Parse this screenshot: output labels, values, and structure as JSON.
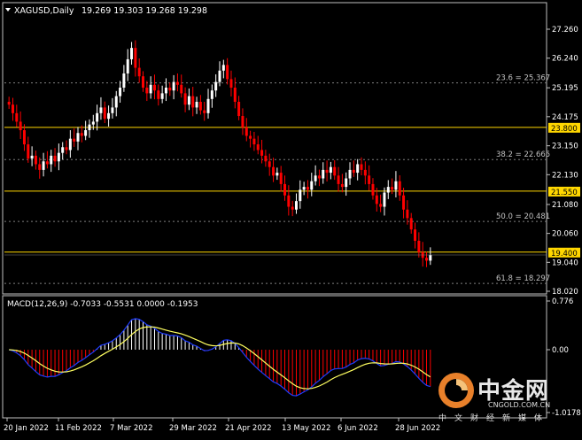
{
  "header": {
    "symbol": "XAGUSD,Daily",
    "ohlc": "19.269 19.303 19.268 19.298"
  },
  "price_axis": {
    "labels": [
      "27.260",
      "26.240",
      "25.195",
      "24.175",
      "23.150",
      "22.130",
      "21.080",
      "20.060",
      "19.040",
      "18.020"
    ],
    "highlighted": [
      {
        "text": "23.800",
        "value": 23.8,
        "color": "#ffd700",
        "text_color": "#000000"
      },
      {
        "text": "21.550",
        "value": 21.55,
        "color": "#ffd700",
        "text_color": "#000000"
      },
      {
        "text": "19.400",
        "value": 19.4,
        "color": "#ffd700",
        "text_color": "#000000"
      }
    ]
  },
  "fib_levels": [
    {
      "label": "23.6 = 25.367",
      "value": 25.367
    },
    {
      "label": "38.2 = 22.665",
      "value": 22.665
    },
    {
      "label": "50.0 = 20.481",
      "value": 20.481
    },
    {
      "label": "61.8 = 18.297",
      "value": 18.297
    }
  ],
  "macd": {
    "label": "MACD(12,26,9) -0.7033 -0.5531 0.0000 -0.1953",
    "axis_labels": [
      "0.776",
      "0.00",
      "-1.0178"
    ]
  },
  "time_axis": [
    "20 Jan 2022",
    "11 Feb 2022",
    "7 Mar 2022",
    "29 Mar 2022",
    "21 Apr 2022",
    "13 May 2022",
    "6 Jun 2022",
    "28 Jun 2022"
  ],
  "watermark": {
    "cn": "中金网",
    "en": "CNGOLD.COM.CN",
    "sub": "中文财经新媒体"
  },
  "colors": {
    "bull": "#ffffff",
    "bear": "#ff0000",
    "fib": "#808080",
    "level": "#ffd700",
    "macd_main": "#1e3cff",
    "macd_signal": "#ffff60",
    "hist_up": "#ffffff",
    "hist_down": "#ff0000"
  },
  "chart_data": {
    "type": "candlestick",
    "ylim": [
      17.9,
      28.1
    ],
    "closes": [
      24.6,
      24.3,
      24.0,
      23.7,
      23.2,
      22.7,
      22.8,
      22.5,
      22.3,
      22.6,
      22.5,
      22.8,
      22.6,
      22.9,
      23.1,
      23.0,
      23.4,
      23.3,
      23.6,
      23.5,
      23.7,
      23.9,
      24.0,
      24.3,
      24.5,
      24.1,
      24.3,
      24.5,
      24.9,
      25.2,
      25.7,
      26.2,
      26.6,
      25.9,
      25.6,
      25.2,
      25.0,
      25.3,
      25.1,
      24.8,
      25.0,
      25.2,
      25.1,
      25.4,
      25.3,
      25.0,
      24.6,
      24.9,
      24.5,
      24.7,
      24.4,
      24.3,
      24.8,
      25.1,
      25.4,
      25.8,
      26.0,
      25.5,
      25.2,
      24.7,
      24.2,
      23.8,
      23.5,
      23.4,
      23.2,
      23.0,
      22.8,
      22.6,
      22.4,
      22.1,
      22.2,
      21.8,
      21.4,
      21.0,
      20.9,
      21.2,
      21.6,
      21.7,
      21.6,
      21.9,
      22.1,
      22.0,
      22.3,
      22.2,
      22.4,
      22.1,
      21.8,
      21.7,
      22.0,
      22.3,
      22.2,
      22.5,
      22.3,
      22.1,
      21.8,
      21.4,
      21.1,
      21.0,
      21.5,
      21.7,
      21.6,
      21.9,
      21.4,
      20.9,
      20.6,
      20.2,
      19.8,
      19.4,
      19.2,
      19.1,
      19.3
    ]
  }
}
